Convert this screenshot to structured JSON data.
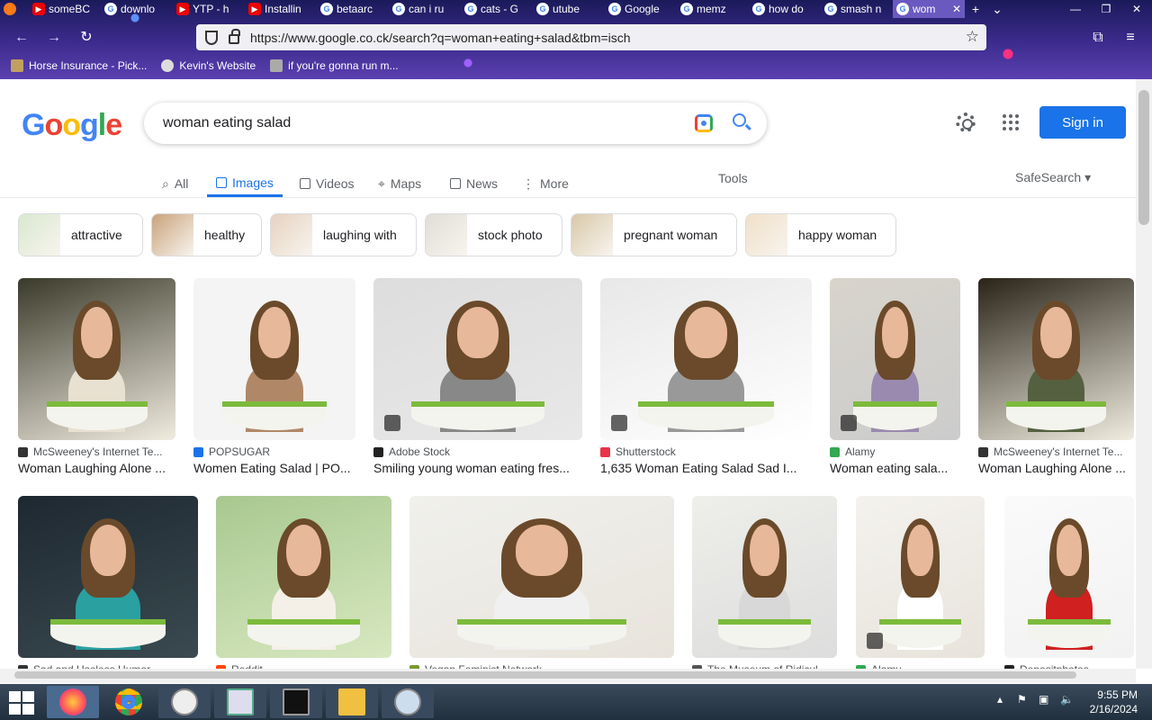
{
  "browser": {
    "tabs": [
      {
        "label": "",
        "icon": "firefox-icon"
      },
      {
        "label": "someBC",
        "icon": "youtube-icon"
      },
      {
        "label": "downlo",
        "icon": "google-icon"
      },
      {
        "label": "YTP - h",
        "icon": "youtube-icon"
      },
      {
        "label": "Installin",
        "icon": "youtube-icon"
      },
      {
        "label": "betaarc",
        "icon": "google-icon"
      },
      {
        "label": "can i ru",
        "icon": "google-icon"
      },
      {
        "label": "cats - G",
        "icon": "google-icon"
      },
      {
        "label": "utube",
        "icon": "google-icon"
      },
      {
        "label": "Google",
        "icon": "google-icon"
      },
      {
        "label": "memz",
        "icon": "google-icon"
      },
      {
        "label": "how do",
        "icon": "google-icon"
      },
      {
        "label": "smash n",
        "icon": "google-icon"
      },
      {
        "label": "wom",
        "icon": "google-icon",
        "active": true
      }
    ],
    "url": "https://www.google.co.ck/search?q=woman+eating+salad&tbm=isch",
    "bookmarks": [
      "Horse Insurance - Pick...",
      "Kevin's Website",
      "if you're gonna run m..."
    ]
  },
  "google": {
    "logo_letters": [
      "G",
      "o",
      "o",
      "g",
      "l",
      "e"
    ],
    "query": "woman eating salad",
    "signin": "Sign in",
    "tabs": [
      "All",
      "Images",
      "Videos",
      "Maps",
      "News",
      "More"
    ],
    "active_tab": "Images",
    "tools": "Tools",
    "safesearch": "SafeSearch",
    "chips": [
      "attractive",
      "healthy",
      "laughing with",
      "stock photo",
      "pregnant woman",
      "happy woman"
    ],
    "row1": [
      {
        "source": "McSweeney's Internet Te...",
        "title": "Woman Laughing Alone ...",
        "src_color": "#333333"
      },
      {
        "source": "POPSUGAR",
        "title": "Women Eating Salad | PO...",
        "src_color": "#1a73e8"
      },
      {
        "source": "Adobe Stock",
        "title": "Smiling young woman eating fres...",
        "src_color": "#222222"
      },
      {
        "source": "Shutterstock",
        "title": "1,635 Woman Eating Salad Sad I...",
        "src_color": "#e8334a"
      },
      {
        "source": "Alamy",
        "title": "Woman eating sala...",
        "src_color": "#34a853"
      },
      {
        "source": "McSweeney's Internet Te...",
        "title": "Woman Laughing Alone ...",
        "src_color": "#333333"
      }
    ],
    "row2_sources": [
      "Sad and Useless Humor",
      "Reddit",
      "Vegan Feminist Network",
      "The Museum of Ridicul...",
      "Alamy",
      "Depositphotos"
    ]
  },
  "taskbar": {
    "time": "9:55 PM",
    "date": "2/16/2024"
  }
}
